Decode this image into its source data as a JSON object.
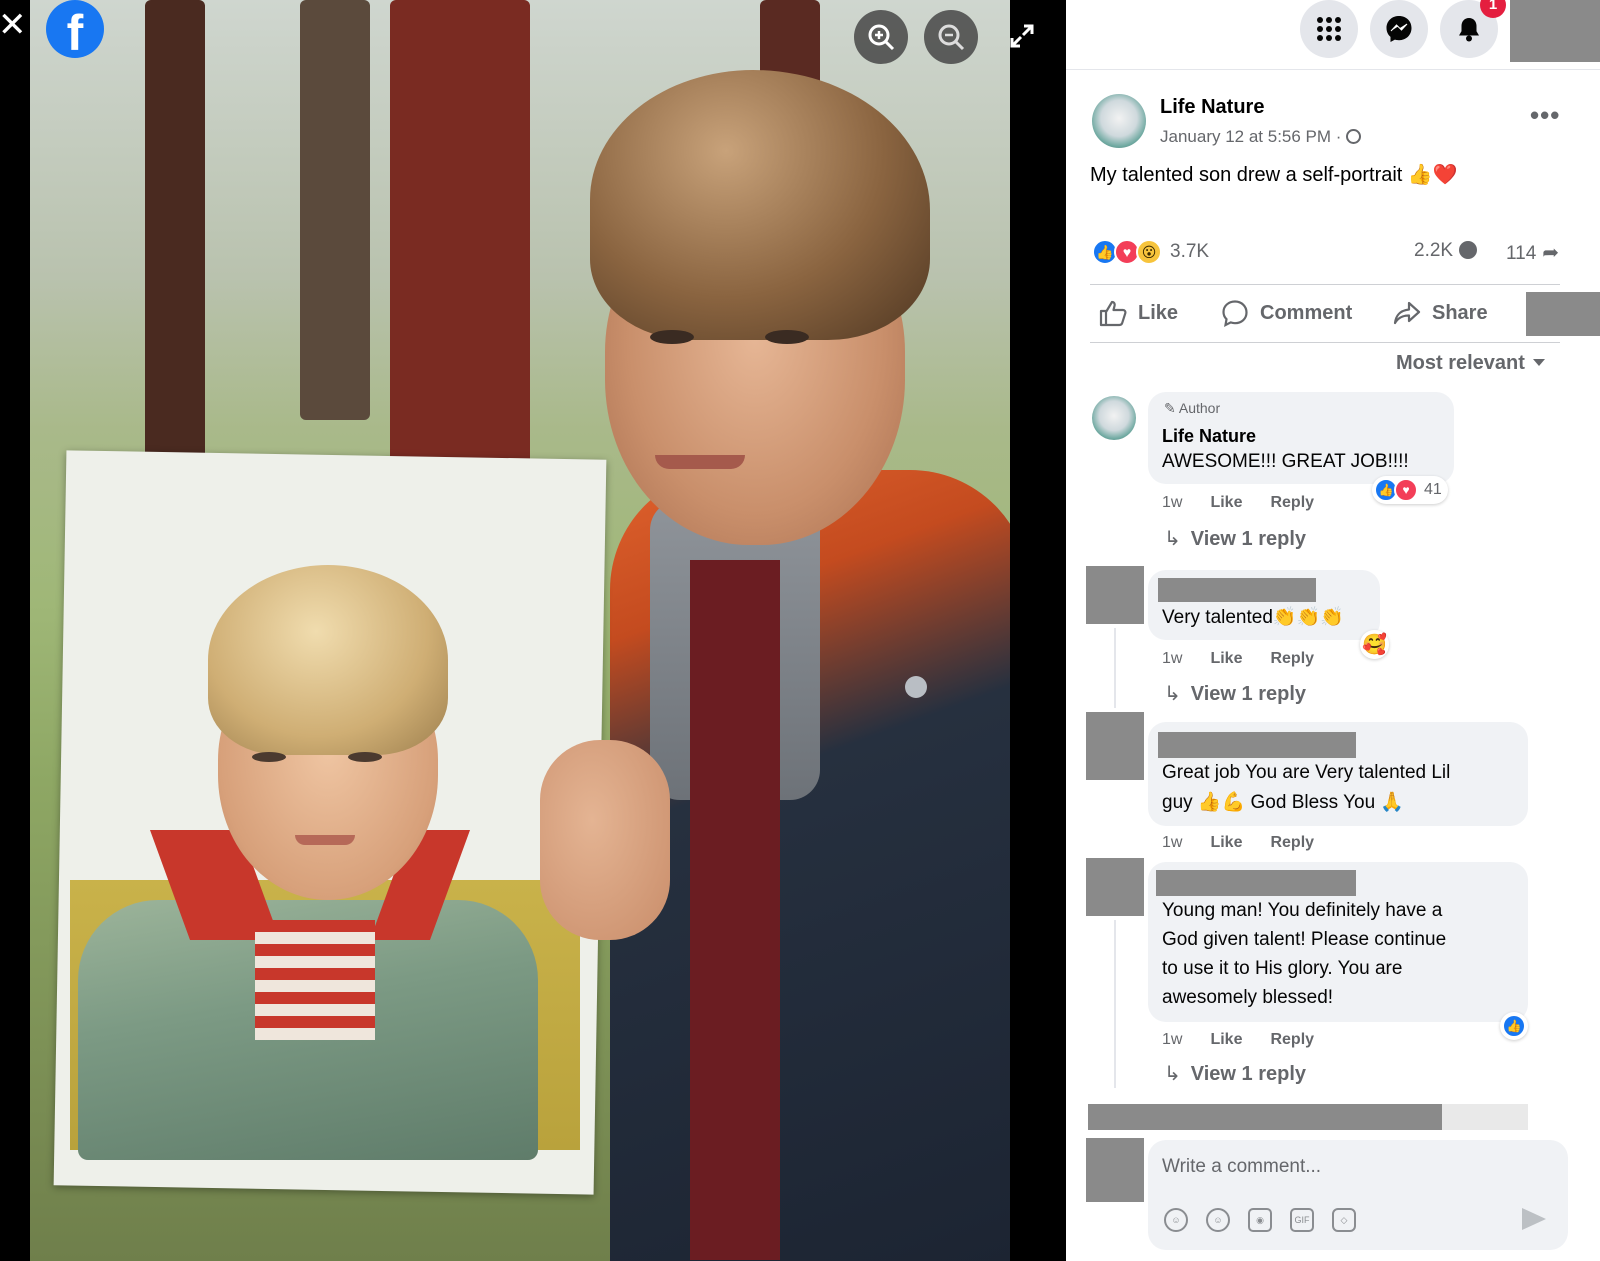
{
  "viewer": {
    "logo_letter": "f",
    "close_glyph": "✕"
  },
  "post": {
    "author": "Life Nature",
    "time": "January 12 at 5:56 PM · ",
    "text": "My talented son drew a self-portrait 👍❤️",
    "reactions_count": "3.7K",
    "comments_count": "2.2K",
    "shares_count": "114",
    "more_glyph": "•••"
  },
  "actions": {
    "like": "Like",
    "comment": "Comment",
    "share": "Share"
  },
  "sort": {
    "label": "Most relevant"
  },
  "comments": [
    {
      "badge": "Author",
      "name": "Life Nature",
      "text": "AWESOME!!! GREAT JOB!!!!",
      "age": "1w",
      "like": "Like",
      "reply": "Reply",
      "reactions": "41",
      "view_replies": "View 1 reply"
    },
    {
      "text": "Very talented👏👏👏",
      "age": "1w",
      "like": "Like",
      "reply": "Reply",
      "reaction_emoji": "🥰",
      "view_replies": "View 1 reply"
    },
    {
      "text_line1": "Great job You are Very talented Lil",
      "text_line2": "guy 👍💪 God Bless You 🙏",
      "age": "1w",
      "like": "Like",
      "reply": "Reply"
    },
    {
      "text_line1": "Young man! You definitely have a",
      "text_line2": "God given talent! Please continue",
      "text_line3": "to use it to His glory. You are",
      "text_line4": "awesomely blessed!",
      "age": "1w",
      "like": "Like",
      "reply": "Reply",
      "view_replies": "View 1 reply"
    }
  ],
  "composer": {
    "placeholder": "Write a comment...",
    "gif_label": "GIF"
  },
  "notifications": {
    "badge": "1"
  },
  "colors": {
    "facebook_blue": "#1877f2",
    "love_red": "#f33e58",
    "badge_red": "#e41e3f",
    "secondary_text": "#65676b"
  }
}
